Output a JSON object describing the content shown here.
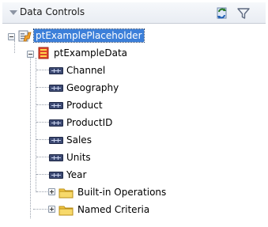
{
  "panel": {
    "title": "Data Controls"
  },
  "tree": {
    "root": {
      "label": "ptExamplePlaceholder"
    },
    "collection": {
      "label": "ptExampleData"
    },
    "attributes": [
      {
        "label": "Channel"
      },
      {
        "label": "Geography"
      },
      {
        "label": "Product"
      },
      {
        "label": "ProductID"
      },
      {
        "label": "Sales"
      },
      {
        "label": "Units"
      },
      {
        "label": "Year"
      }
    ],
    "folders": [
      {
        "label": "Built-in Operations"
      },
      {
        "label": "Named Criteria"
      }
    ]
  },
  "icons": {
    "header_collapse": "collapse-triangle-icon",
    "refresh": "refresh-icon",
    "filter": "filter-icon",
    "root": "data-control-icon",
    "collection": "collection-icon",
    "attribute": "attribute-icon",
    "folder": "folder-icon"
  },
  "colors": {
    "selection": "#3c7fd9",
    "folder": "#f2c744",
    "collection": "#e0442b"
  }
}
